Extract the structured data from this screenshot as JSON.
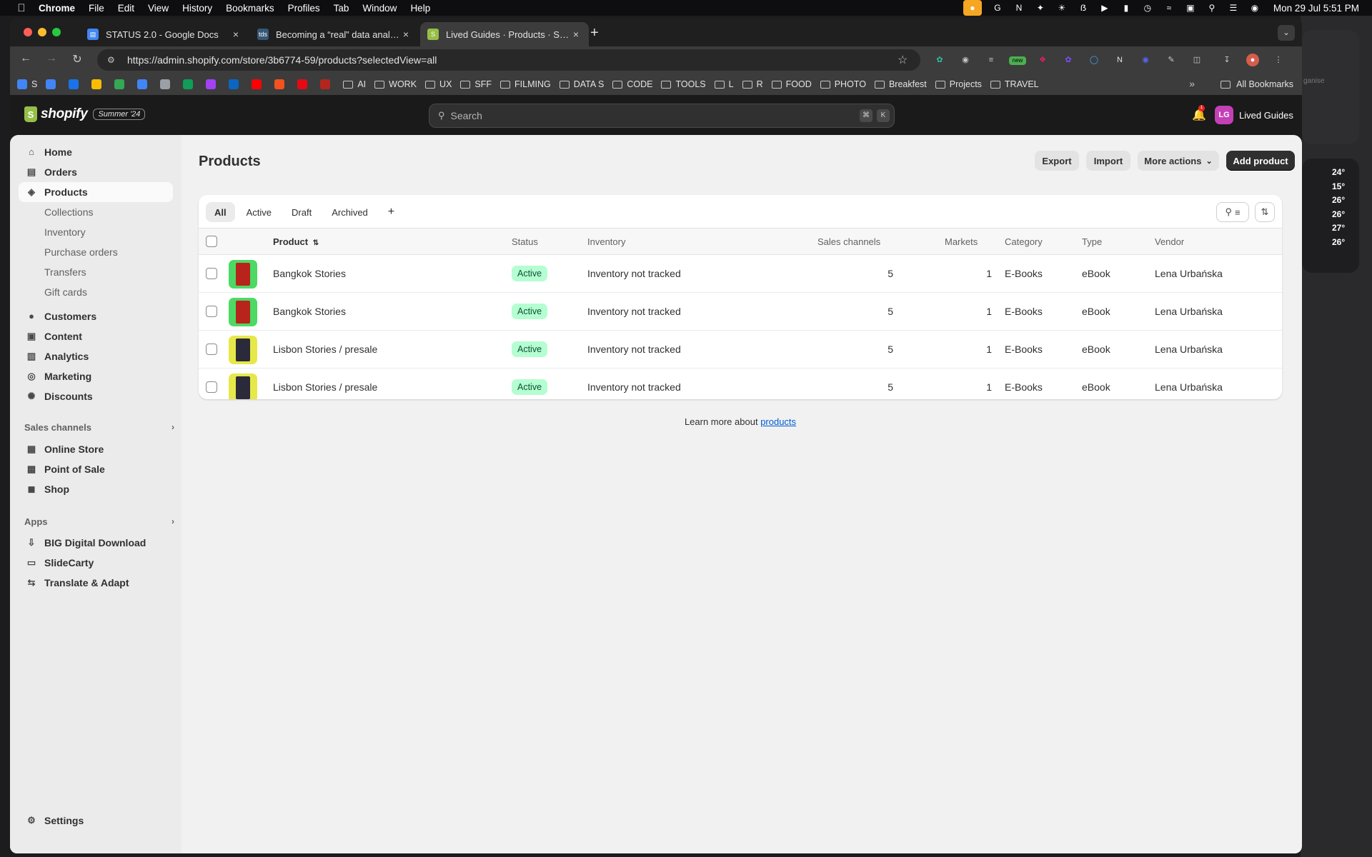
{
  "menubar": {
    "app": "Chrome",
    "items": [
      "File",
      "Edit",
      "View",
      "History",
      "Bookmarks",
      "Profiles",
      "Tab",
      "Window",
      "Help"
    ],
    "clock": "Mon 29 Jul  5:51 PM"
  },
  "browser": {
    "tabs": [
      {
        "title": "STATUS 2.0 - Google Docs",
        "favicon": "docs-icon",
        "color": "#4285f4"
      },
      {
        "title": "Becoming a “real” data analyst",
        "favicon": "tds-icon",
        "color": "#355876"
      },
      {
        "title": "Lived Guides · Products · Shopify",
        "favicon": "shopify-icon",
        "color": "#95bf47"
      }
    ],
    "url": "https://admin.shopify.com/store/3b6774-59/products?selectedView=all",
    "bookmarks": [
      {
        "label": "S",
        "type": "site",
        "color": "#4285f4"
      },
      {
        "label": "",
        "type": "site",
        "color": "#4285f4"
      },
      {
        "label": "",
        "type": "site",
        "color": "#1a73e8"
      },
      {
        "label": "",
        "type": "site",
        "color": "#fbbc04"
      },
      {
        "label": "",
        "type": "site",
        "color": "#34a853"
      },
      {
        "label": "",
        "type": "site",
        "color": "#4285f4"
      },
      {
        "label": "",
        "type": "site",
        "color": "#9aa0a6"
      },
      {
        "label": "",
        "type": "site",
        "color": "#0f9d58"
      },
      {
        "label": "",
        "type": "site",
        "color": "#a142f4"
      },
      {
        "label": "",
        "type": "site",
        "color": "#0a66c2"
      },
      {
        "label": "",
        "type": "site",
        "color": "#ff0000"
      },
      {
        "label": "",
        "type": "site",
        "color": "#f4511e"
      },
      {
        "label": "",
        "type": "site",
        "color": "#e50914"
      },
      {
        "label": "",
        "type": "site",
        "color": "#b3261e"
      },
      {
        "label": "AI",
        "type": "folder"
      },
      {
        "label": "WORK",
        "type": "folder"
      },
      {
        "label": "UX",
        "type": "folder"
      },
      {
        "label": "SFF",
        "type": "folder"
      },
      {
        "label": "FILMING",
        "type": "folder"
      },
      {
        "label": "DATA S",
        "type": "folder"
      },
      {
        "label": "CODE",
        "type": "folder"
      },
      {
        "label": "TOOLS",
        "type": "folder"
      },
      {
        "label": "L",
        "type": "folder"
      },
      {
        "label": "R",
        "type": "folder"
      },
      {
        "label": "FOOD",
        "type": "folder"
      },
      {
        "label": "PHOTO",
        "type": "folder"
      },
      {
        "label": "Breakfest",
        "type": "folder"
      },
      {
        "label": "Projects",
        "type": "folder"
      },
      {
        "label": "TRAVEL",
        "type": "folder"
      }
    ],
    "all_bookmarks": "All Bookmarks",
    "ext_badge": "new"
  },
  "topbar": {
    "brand": "shopify",
    "edition": "Summer '24",
    "search_placeholder": "Search",
    "shortcut_1": "⌘",
    "shortcut_2": "K",
    "notifications": "1",
    "store_initials": "LG",
    "store_name": "Lived Guides"
  },
  "sidebar": {
    "items": [
      {
        "label": "Home",
        "icon": "home-icon"
      },
      {
        "label": "Orders",
        "icon": "inbox-icon"
      },
      {
        "label": "Products",
        "icon": "tag-icon",
        "selected": true
      },
      {
        "label": "Collections",
        "sub": true
      },
      {
        "label": "Inventory",
        "sub": true
      },
      {
        "label": "Purchase orders",
        "sub": true
      },
      {
        "label": "Transfers",
        "sub": true
      },
      {
        "label": "Gift cards",
        "sub": true
      },
      {
        "label": "Customers",
        "icon": "person-icon"
      },
      {
        "label": "Content",
        "icon": "content-icon"
      },
      {
        "label": "Analytics",
        "icon": "analytics-icon"
      },
      {
        "label": "Marketing",
        "icon": "marketing-icon"
      },
      {
        "label": "Discounts",
        "icon": "discount-icon"
      }
    ],
    "sales_channels_title": "Sales channels",
    "sales_channels": [
      {
        "label": "Online Store",
        "icon": "store-icon"
      },
      {
        "label": "Point of Sale",
        "icon": "pos-icon"
      },
      {
        "label": "Shop",
        "icon": "shop-icon"
      }
    ],
    "apps_title": "Apps",
    "apps": [
      {
        "label": "BIG Digital Download",
        "icon": "download-app-icon"
      },
      {
        "label": "SlideCarty",
        "icon": "slidecarty-app-icon"
      },
      {
        "label": "Translate & Adapt",
        "icon": "translate-app-icon"
      }
    ],
    "settings": "Settings"
  },
  "page": {
    "title": "Products",
    "export": "Export",
    "import": "Import",
    "more_actions": "More actions",
    "add_product": "Add product",
    "tabs": [
      "All",
      "Active",
      "Draft",
      "Archived"
    ],
    "add_view": "+",
    "columns": {
      "product": "Product",
      "status": "Status",
      "inventory": "Inventory",
      "sales_channels": "Sales channels",
      "markets": "Markets",
      "category": "Category",
      "type": "Type",
      "vendor": "Vendor"
    },
    "rows": [
      {
        "name": "Bangkok Stories",
        "status": "Active",
        "inventory": "Inventory not tracked",
        "sales_channels": "5",
        "markets": "1",
        "category": "E-Books",
        "type": "eBook",
        "vendor": "Lena Urbańska",
        "thumb_bg": "#4cd964",
        "cover": "#b8241c"
      },
      {
        "name": "Bangkok Stories",
        "status": "Active",
        "inventory": "Inventory not tracked",
        "sales_channels": "5",
        "markets": "1",
        "category": "E-Books",
        "type": "eBook",
        "vendor": "Lena Urbańska",
        "thumb_bg": "#4cd964",
        "cover": "#b8241c"
      },
      {
        "name": "Lisbon Stories / presale",
        "status": "Active",
        "inventory": "Inventory not tracked",
        "sales_channels": "5",
        "markets": "1",
        "category": "E-Books",
        "type": "eBook",
        "vendor": "Lena Urbańska",
        "thumb_bg": "#e6e84a",
        "cover": "#2a2a3a"
      },
      {
        "name": "Lisbon Stories / presale",
        "status": "Active",
        "inventory": "Inventory not tracked",
        "sales_channels": "5",
        "markets": "1",
        "category": "E-Books",
        "type": "eBook",
        "vendor": "Lena Urbańska",
        "thumb_bg": "#e6e84a",
        "cover": "#2a2a3a"
      }
    ],
    "learn_more": "Learn more about",
    "learn_more_link": "products"
  },
  "weather": [
    "24°",
    "15°",
    "26°",
    "26°",
    "27°",
    "26°"
  ],
  "widget_text": "ganise"
}
